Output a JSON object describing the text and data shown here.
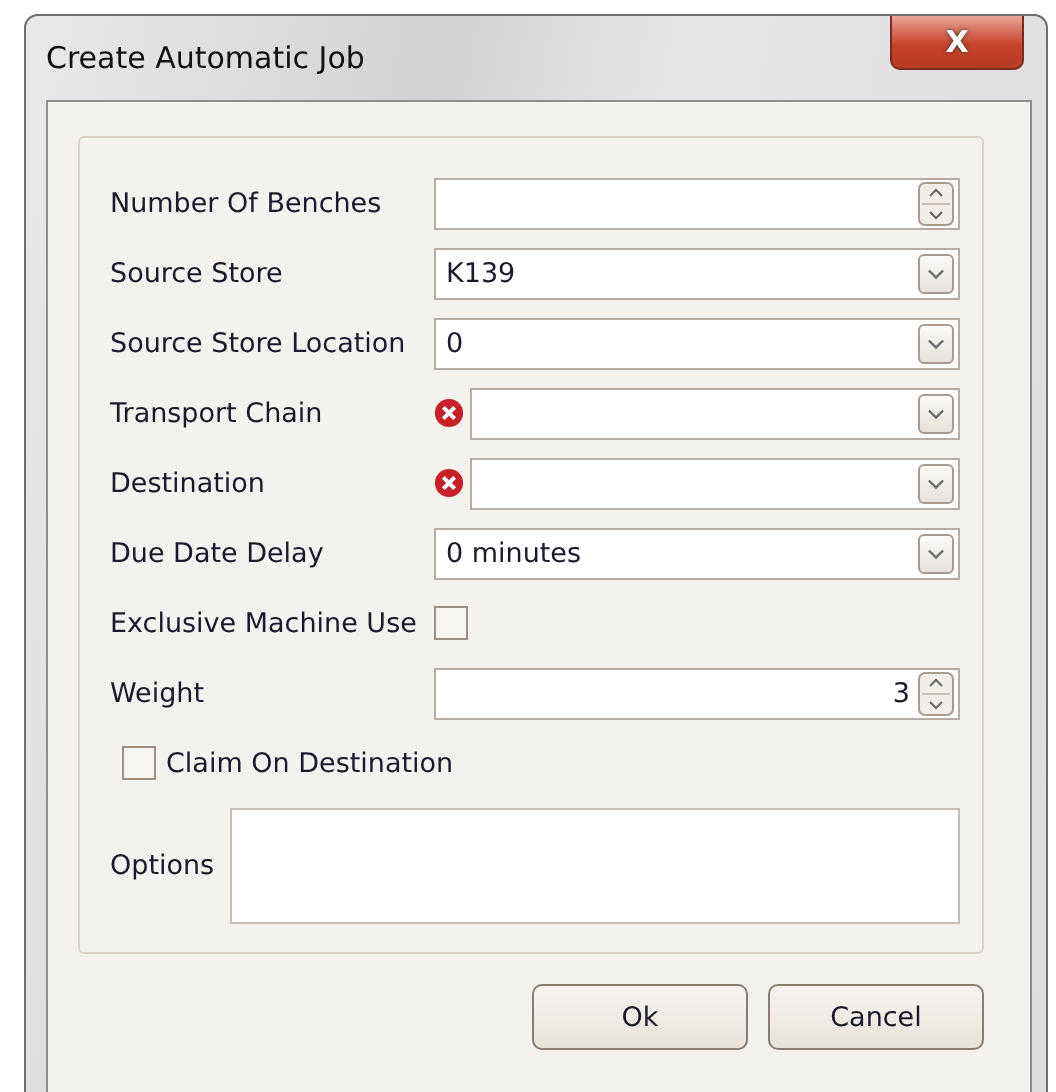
{
  "window": {
    "title": "Create Automatic Job",
    "close": "X"
  },
  "fields": [
    {
      "kind": "spin",
      "label": "Number Of Benches",
      "error": false
    },
    {
      "kind": "combo",
      "label": "Source Store",
      "value": "K139",
      "error": false
    },
    {
      "kind": "combo",
      "label": "Source Store Location",
      "value": "0",
      "error": false
    },
    {
      "kind": "combo",
      "label": "Transport Chain",
      "error": true
    },
    {
      "kind": "combo",
      "label": "Destination",
      "error": true
    },
    {
      "kind": "combo",
      "label": "Due Date Delay",
      "value": "0 minutes",
      "error": false
    },
    {
      "kind": "check",
      "label": "Exclusive Machine Use",
      "checked": false
    },
    {
      "kind": "spin",
      "label": "Weight",
      "value": "3",
      "error": false
    },
    {
      "kind": "checkrow",
      "label": "Claim On Destination",
      "checked": false
    },
    {
      "kind": "memo",
      "label": "Options"
    }
  ],
  "buttons": [
    "Ok",
    "Cancel"
  ]
}
